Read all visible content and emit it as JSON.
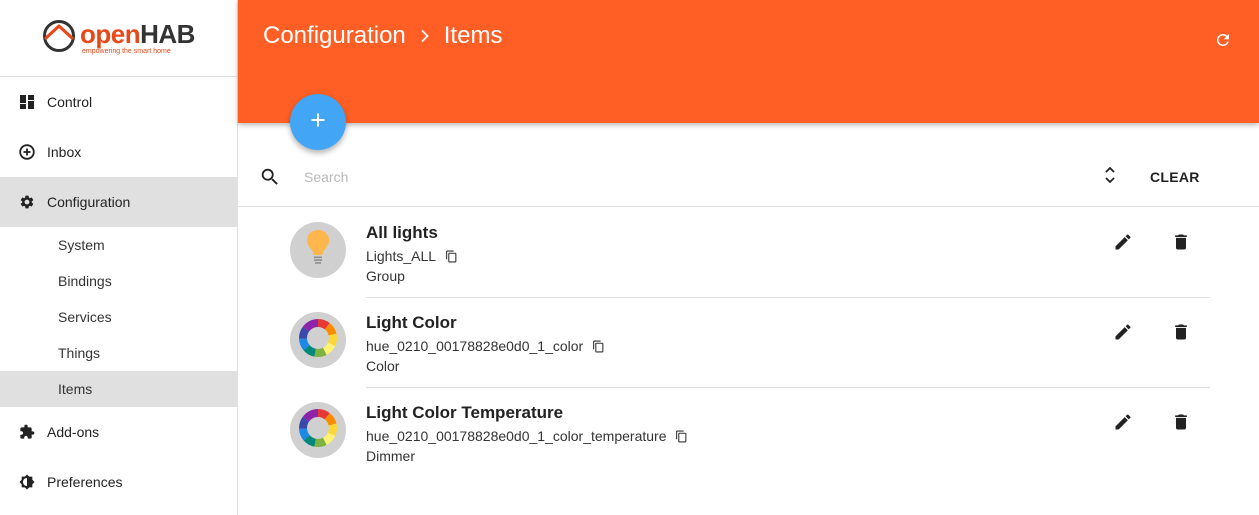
{
  "brand": {
    "word_open": "open",
    "word_hab": "HAB",
    "tagline": "empowering the smart home",
    "accent_color": "#e64a19"
  },
  "sidebar": {
    "items": [
      {
        "label": "Control",
        "icon": "dashboard-icon"
      },
      {
        "label": "Inbox",
        "icon": "add-circle-icon"
      },
      {
        "label": "Configuration",
        "icon": "gear-icon",
        "active": true
      },
      {
        "label": "Add-ons",
        "icon": "puzzle-icon"
      },
      {
        "label": "Preferences",
        "icon": "brightness-icon"
      }
    ],
    "config_sub_items": [
      {
        "label": "System"
      },
      {
        "label": "Bindings"
      },
      {
        "label": "Services"
      },
      {
        "label": "Things"
      },
      {
        "label": "Items",
        "active": true
      }
    ]
  },
  "header": {
    "breadcrumb_parent": "Configuration",
    "breadcrumb_current": "Items",
    "color": "#ff5f25"
  },
  "fab": {
    "icon": "plus-icon",
    "color": "#42a5f5"
  },
  "search": {
    "placeholder": "Search",
    "value": "",
    "clear_label": "CLEAR"
  },
  "items": [
    {
      "title": "All lights",
      "name": "Lights_ALL",
      "type": "Group",
      "icon": "lightbulb-icon"
    },
    {
      "title": "Light Color",
      "name": "hue_0210_00178828e0d0_1_color",
      "type": "Color",
      "icon": "color-wheel-icon"
    },
    {
      "title": "Light Color Temperature",
      "name": "hue_0210_00178828e0d0_1_color_temperature",
      "type": "Dimmer",
      "icon": "color-wheel-icon"
    }
  ]
}
